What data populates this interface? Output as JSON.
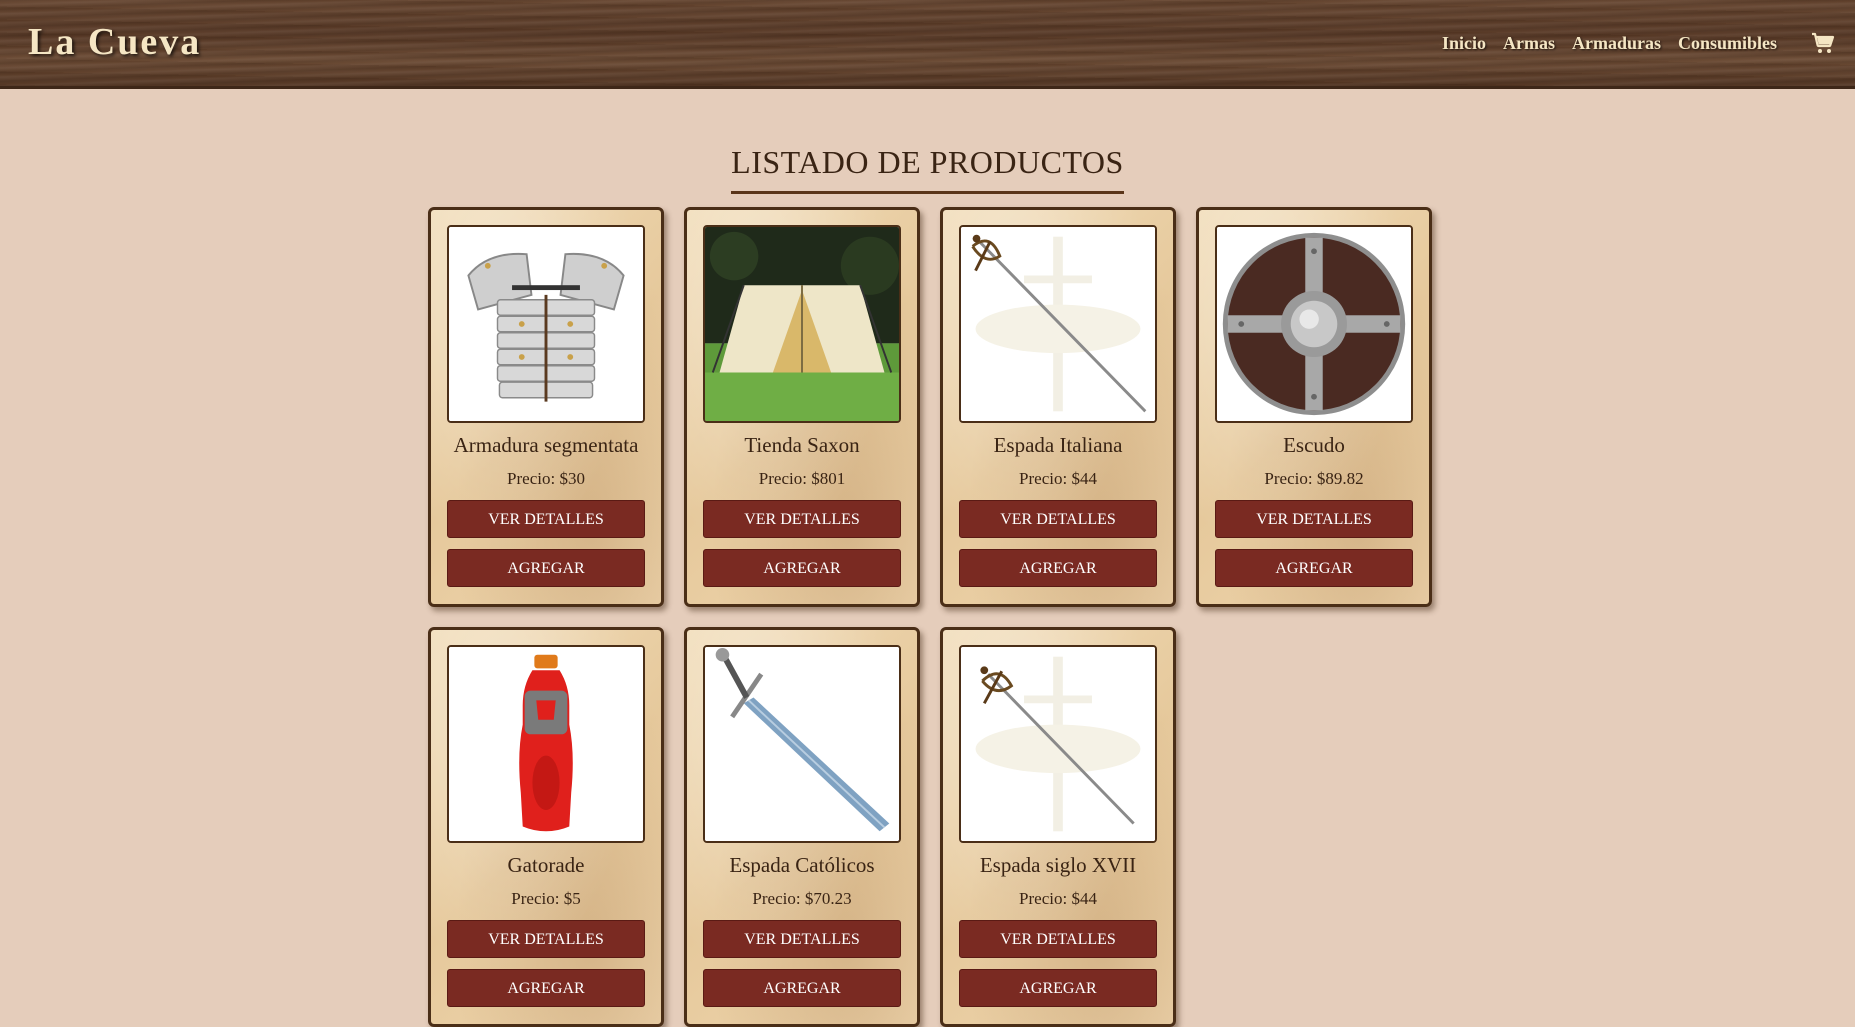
{
  "brand": "La Cueva",
  "nav": {
    "links": [
      "Inicio",
      "Armas",
      "Armaduras",
      "Consumibles"
    ],
    "cart_icon": "shopping-cart-icon"
  },
  "page_title": "LISTADO DE PRODUCTOS",
  "buttons": {
    "details": "VER DETALLES",
    "add": "AGREGAR"
  },
  "products": [
    {
      "name": "Armadura segmentata",
      "price": "Precio: $30",
      "image": "segmented-armor"
    },
    {
      "name": "Tienda Saxon",
      "price": "Precio: $801",
      "image": "tent"
    },
    {
      "name": "Espada Italiana",
      "price": "Precio: $44",
      "image": "rapier-sword"
    },
    {
      "name": "Escudo",
      "price": "Precio: $89.82",
      "image": "round-shield"
    },
    {
      "name": "Gatorade",
      "price": "Precio: $5",
      "image": "sports-drink-bottle"
    },
    {
      "name": "Espada Católicos",
      "price": "Precio: $70.23",
      "image": "longsword"
    },
    {
      "name": "Espada siglo XVII",
      "price": "Precio: $44",
      "image": "rapier-sword"
    }
  ],
  "colors": {
    "background": "#e5cdbb",
    "button": "#7a2a22",
    "nav_text": "#f5e6c4",
    "border": "#4a2e17"
  }
}
